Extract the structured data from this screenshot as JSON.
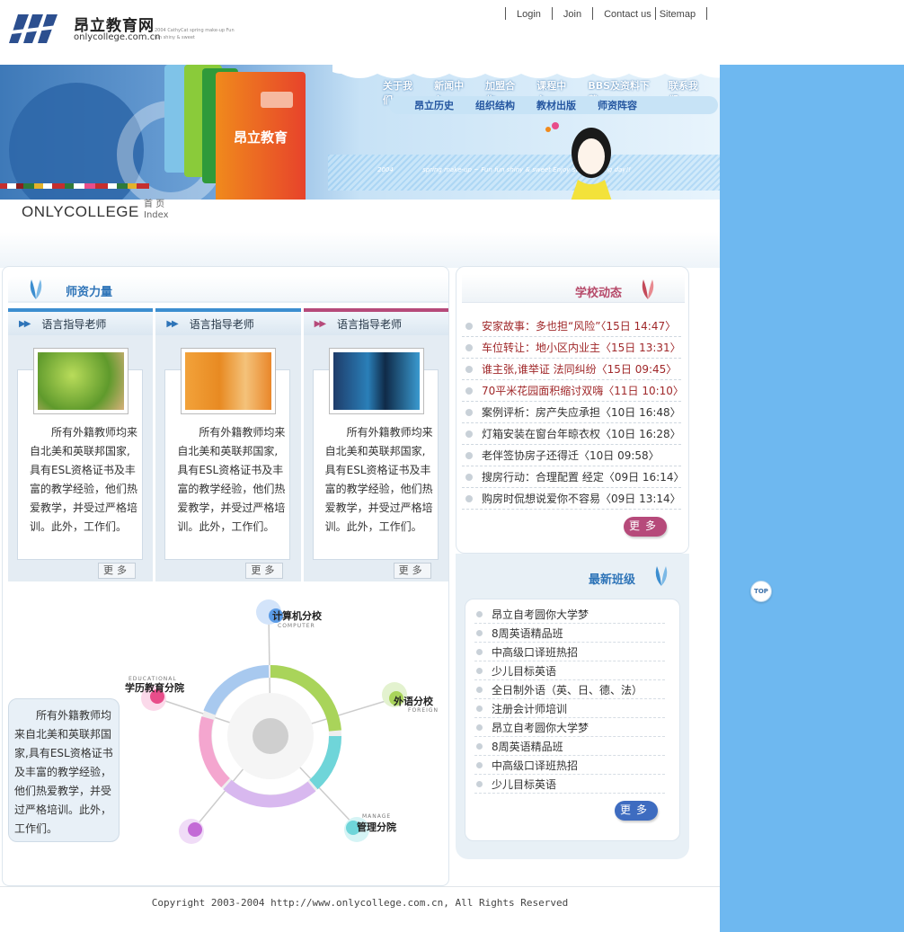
{
  "colors": {
    "accent_blue": "#2e74b8",
    "accent_red": "#b64a6a",
    "side_bg": "#6eb8f0"
  },
  "logo": {
    "cn": "昂立教育网",
    "en": "onlycollege.com.cn",
    "tag": "2004 CathyCat spring make-up Fun fun shiny & sweet"
  },
  "topnav": [
    "Login",
    "Join",
    "Contact us",
    "Sitemap"
  ],
  "mainnav": [
    "关于我们",
    "新闻中心",
    "加盟合作",
    "课程中心",
    "BBS及资料下载",
    "联系我们"
  ],
  "subnav": [
    "昂立历史",
    "组织结构",
    "教材出版",
    "师资阵容"
  ],
  "banner": {
    "book_label": "昂立教育",
    "slogan_year": "2004",
    "slogan": "spring make-up ~ Fun fun shiny & sweet Enjoy sweet spring day!!"
  },
  "brand": {
    "name": "ONLYCOLLEGE",
    "sub_cn": "首 页",
    "sub_en": "Index"
  },
  "teachers": {
    "title": "师资力量",
    "cards": [
      {
        "heading": "语言指导老师",
        "text": "　　所有外籍教师均来自北美和英联邦国家,具有ESL资格证书及丰富的教学经验，他们热爱教学，并受过严格培训。此外，工作们。",
        "more": "更多"
      },
      {
        "heading": "语言指导老师",
        "text": "　　所有外籍教师均来自北美和英联邦国家,具有ESL资格证书及丰富的教学经验，他们热爱教学，并受过严格培训。此外，工作们。",
        "more": "更多"
      },
      {
        "heading": "语言指导老师",
        "text": "　　所有外籍教师均来自北美和英联邦国家,具有ESL资格证书及丰富的教学经验，他们热爱教学，并受过严格培训。此外，工作们。",
        "more": "更多"
      }
    ]
  },
  "campus": {
    "intro": "　　所有外籍教师均来自北美和英联邦国家,具有ESL资格证书及丰富的教学经验，他们热爱教学，并受过严格培训。此外，工作们。",
    "nodes": [
      {
        "label": "计算机分校",
        "sub": "COMPUTER"
      },
      {
        "label": "外语分校",
        "sub": "FOREIGN"
      },
      {
        "label": "管理分院",
        "sub": "MANAGE"
      },
      {
        "label": "学历教育分院",
        "sub": "EDUCATIONAL"
      }
    ]
  },
  "news": {
    "title": "学校动态",
    "items": [
      {
        "text": "安家故事：多也担“风险”〈15日 14:47〉",
        "hot": true
      },
      {
        "text": "车位转让：地小区内业主〈15日 13:31〉",
        "hot": true
      },
      {
        "text": "谁主张,谁举证 法同纠纷〈15日 09:45〉",
        "hot": true
      },
      {
        "text": "70平米花园面积缩讨双嗨〈11日 10:10〉",
        "hot": true
      },
      {
        "text": "案例评析：房产失应承担〈10日 16:48〉",
        "hot": false
      },
      {
        "text": "灯箱安装在窗台年晾衣权〈10日 16:28〉",
        "hot": false
      },
      {
        "text": "老伴签协房子还得迁〈10日 09:58〉",
        "hot": false
      },
      {
        "text": "搜房行动：合理配置 经定〈09日 16:14〉",
        "hot": false
      },
      {
        "text": "购房时侃想说爱你不容易〈09日 13:14〉",
        "hot": false
      }
    ],
    "more": "更多"
  },
  "classes": {
    "title": "最新班级",
    "items": [
      "昂立自考圆你大学梦",
      "8周英语精品班",
      "中高级口译班热招",
      "少儿目标英语",
      "全日制外语（英、日、德、法）",
      "注册会计师培训",
      "昂立自考圆你大学梦",
      "8周英语精品班",
      "中高级口译班热招",
      "少儿目标英语"
    ],
    "more": "更多"
  },
  "top_label": "TOP",
  "footer": "Copyright 2003-2004 http://www.onlycollege.com.cn, All Rights Reserved"
}
